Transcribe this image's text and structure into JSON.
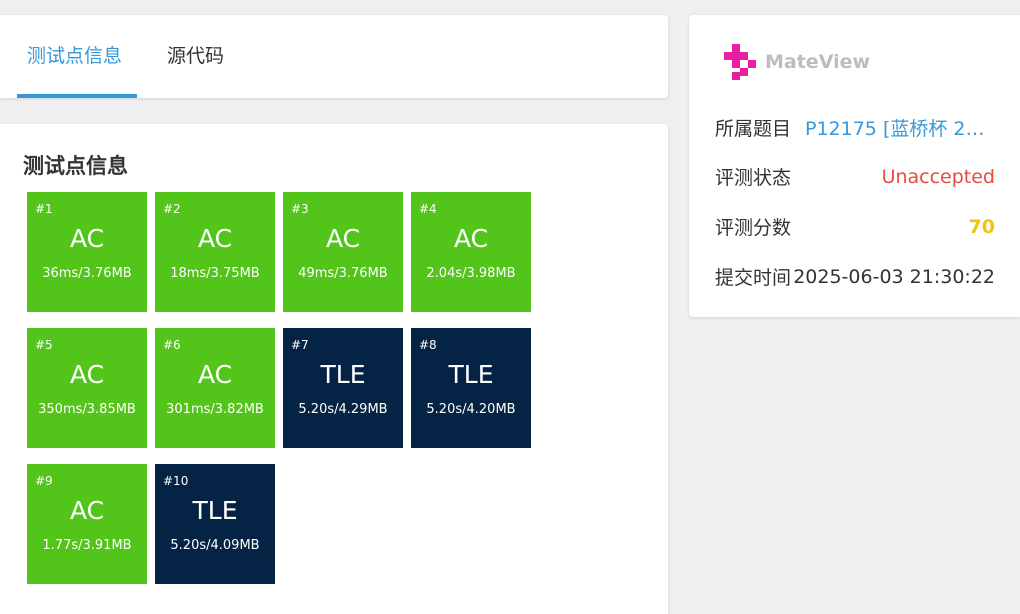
{
  "tabs": [
    {
      "label": "测试点信息",
      "active": true
    },
    {
      "label": "源代码",
      "active": false
    }
  ],
  "section_title": "测试点信息",
  "cases": [
    {
      "num": "#1",
      "status": "AC",
      "info": "36ms/3.76MB"
    },
    {
      "num": "#2",
      "status": "AC",
      "info": "18ms/3.75MB"
    },
    {
      "num": "#3",
      "status": "AC",
      "info": "49ms/3.76MB"
    },
    {
      "num": "#4",
      "status": "AC",
      "info": "2.04s/3.98MB"
    },
    {
      "num": "#5",
      "status": "AC",
      "info": "350ms/3.85MB"
    },
    {
      "num": "#6",
      "status": "AC",
      "info": "301ms/3.82MB"
    },
    {
      "num": "#7",
      "status": "TLE",
      "info": "5.20s/4.29MB"
    },
    {
      "num": "#8",
      "status": "TLE",
      "info": "5.20s/4.20MB"
    },
    {
      "num": "#9",
      "status": "AC",
      "info": "1.77s/3.91MB"
    },
    {
      "num": "#10",
      "status": "TLE",
      "info": "5.20s/4.09MB"
    }
  ],
  "colors": {
    "ac": "#52c41a",
    "tle": "#052344",
    "accent": "#3498db",
    "logo": "#e91ea0"
  },
  "side": {
    "logo_text": "MateView",
    "problem_label": "所属题目",
    "problem_value": "P12175 [蓝桥杯 20...",
    "status_label": "评测状态",
    "status_value": "Unaccepted",
    "score_label": "评测分数",
    "score_value": "70",
    "time_label": "提交时间",
    "time_value": "2025-06-03 21:30:22"
  }
}
